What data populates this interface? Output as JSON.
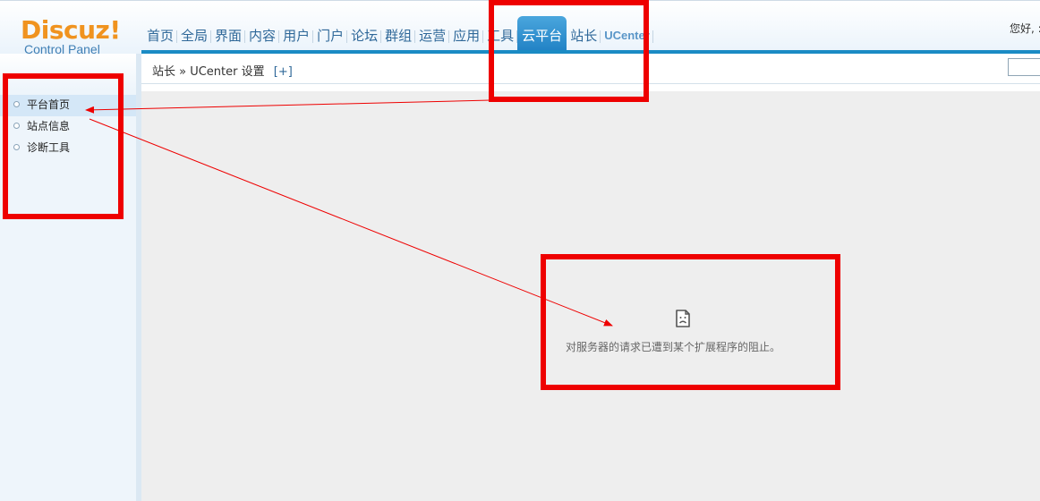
{
  "logo": {
    "name": "Discuz!",
    "subtitle": "Control Panel"
  },
  "nav": {
    "tabs": [
      {
        "label": "首页"
      },
      {
        "label": "全局"
      },
      {
        "label": "界面"
      },
      {
        "label": "内容"
      },
      {
        "label": "用户"
      },
      {
        "label": "门户"
      },
      {
        "label": "论坛"
      },
      {
        "label": "群组"
      },
      {
        "label": "运营"
      },
      {
        "label": "应用"
      },
      {
        "label": "工具"
      },
      {
        "label": "云平台",
        "active": true
      },
      {
        "label": "站长"
      },
      {
        "label": "UCenter"
      }
    ]
  },
  "header": {
    "greeting": "您好, :"
  },
  "breadcrumb": {
    "text": "站长 » UCenter 设置",
    "expand": "[+]"
  },
  "sidebar": {
    "items": [
      {
        "label": "平台首页",
        "active": true
      },
      {
        "label": "站点信息"
      },
      {
        "label": "诊断工具"
      }
    ]
  },
  "content": {
    "error_icon": "broken-page-icon",
    "error_message": "对服务器的请求已遭到某个扩展程序的阻止。"
  },
  "colors": {
    "annotation": "#ee0000",
    "nav_active": "#1f80c4",
    "nav_text": "#2f6899",
    "logo_orange": "#f0931f",
    "accent_line": "#1a8bc4"
  }
}
